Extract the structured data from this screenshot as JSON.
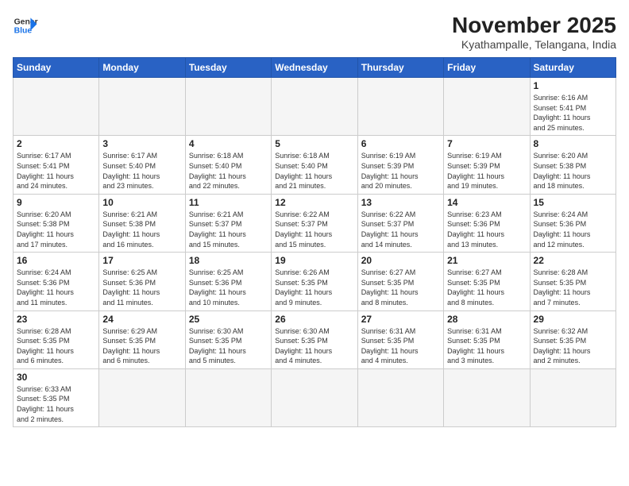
{
  "header": {
    "logo_line1": "General",
    "logo_line2": "Blue",
    "month_title": "November 2025",
    "subtitle": "Kyathampalle, Telangana, India"
  },
  "weekdays": [
    "Sunday",
    "Monday",
    "Tuesday",
    "Wednesday",
    "Thursday",
    "Friday",
    "Saturday"
  ],
  "weeks": [
    [
      {
        "day": "",
        "info": ""
      },
      {
        "day": "",
        "info": ""
      },
      {
        "day": "",
        "info": ""
      },
      {
        "day": "",
        "info": ""
      },
      {
        "day": "",
        "info": ""
      },
      {
        "day": "",
        "info": ""
      },
      {
        "day": "1",
        "info": "Sunrise: 6:16 AM\nSunset: 5:41 PM\nDaylight: 11 hours\nand 25 minutes."
      }
    ],
    [
      {
        "day": "2",
        "info": "Sunrise: 6:17 AM\nSunset: 5:41 PM\nDaylight: 11 hours\nand 24 minutes."
      },
      {
        "day": "3",
        "info": "Sunrise: 6:17 AM\nSunset: 5:40 PM\nDaylight: 11 hours\nand 23 minutes."
      },
      {
        "day": "4",
        "info": "Sunrise: 6:18 AM\nSunset: 5:40 PM\nDaylight: 11 hours\nand 22 minutes."
      },
      {
        "day": "5",
        "info": "Sunrise: 6:18 AM\nSunset: 5:40 PM\nDaylight: 11 hours\nand 21 minutes."
      },
      {
        "day": "6",
        "info": "Sunrise: 6:19 AM\nSunset: 5:39 PM\nDaylight: 11 hours\nand 20 minutes."
      },
      {
        "day": "7",
        "info": "Sunrise: 6:19 AM\nSunset: 5:39 PM\nDaylight: 11 hours\nand 19 minutes."
      },
      {
        "day": "8",
        "info": "Sunrise: 6:20 AM\nSunset: 5:38 PM\nDaylight: 11 hours\nand 18 minutes."
      }
    ],
    [
      {
        "day": "9",
        "info": "Sunrise: 6:20 AM\nSunset: 5:38 PM\nDaylight: 11 hours\nand 17 minutes."
      },
      {
        "day": "10",
        "info": "Sunrise: 6:21 AM\nSunset: 5:38 PM\nDaylight: 11 hours\nand 16 minutes."
      },
      {
        "day": "11",
        "info": "Sunrise: 6:21 AM\nSunset: 5:37 PM\nDaylight: 11 hours\nand 15 minutes."
      },
      {
        "day": "12",
        "info": "Sunrise: 6:22 AM\nSunset: 5:37 PM\nDaylight: 11 hours\nand 15 minutes."
      },
      {
        "day": "13",
        "info": "Sunrise: 6:22 AM\nSunset: 5:37 PM\nDaylight: 11 hours\nand 14 minutes."
      },
      {
        "day": "14",
        "info": "Sunrise: 6:23 AM\nSunset: 5:36 PM\nDaylight: 11 hours\nand 13 minutes."
      },
      {
        "day": "15",
        "info": "Sunrise: 6:24 AM\nSunset: 5:36 PM\nDaylight: 11 hours\nand 12 minutes."
      }
    ],
    [
      {
        "day": "16",
        "info": "Sunrise: 6:24 AM\nSunset: 5:36 PM\nDaylight: 11 hours\nand 11 minutes."
      },
      {
        "day": "17",
        "info": "Sunrise: 6:25 AM\nSunset: 5:36 PM\nDaylight: 11 hours\nand 11 minutes."
      },
      {
        "day": "18",
        "info": "Sunrise: 6:25 AM\nSunset: 5:36 PM\nDaylight: 11 hours\nand 10 minutes."
      },
      {
        "day": "19",
        "info": "Sunrise: 6:26 AM\nSunset: 5:35 PM\nDaylight: 11 hours\nand 9 minutes."
      },
      {
        "day": "20",
        "info": "Sunrise: 6:27 AM\nSunset: 5:35 PM\nDaylight: 11 hours\nand 8 minutes."
      },
      {
        "day": "21",
        "info": "Sunrise: 6:27 AM\nSunset: 5:35 PM\nDaylight: 11 hours\nand 8 minutes."
      },
      {
        "day": "22",
        "info": "Sunrise: 6:28 AM\nSunset: 5:35 PM\nDaylight: 11 hours\nand 7 minutes."
      }
    ],
    [
      {
        "day": "23",
        "info": "Sunrise: 6:28 AM\nSunset: 5:35 PM\nDaylight: 11 hours\nand 6 minutes."
      },
      {
        "day": "24",
        "info": "Sunrise: 6:29 AM\nSunset: 5:35 PM\nDaylight: 11 hours\nand 6 minutes."
      },
      {
        "day": "25",
        "info": "Sunrise: 6:30 AM\nSunset: 5:35 PM\nDaylight: 11 hours\nand 5 minutes."
      },
      {
        "day": "26",
        "info": "Sunrise: 6:30 AM\nSunset: 5:35 PM\nDaylight: 11 hours\nand 4 minutes."
      },
      {
        "day": "27",
        "info": "Sunrise: 6:31 AM\nSunset: 5:35 PM\nDaylight: 11 hours\nand 4 minutes."
      },
      {
        "day": "28",
        "info": "Sunrise: 6:31 AM\nSunset: 5:35 PM\nDaylight: 11 hours\nand 3 minutes."
      },
      {
        "day": "29",
        "info": "Sunrise: 6:32 AM\nSunset: 5:35 PM\nDaylight: 11 hours\nand 2 minutes."
      }
    ],
    [
      {
        "day": "30",
        "info": "Sunrise: 6:33 AM\nSunset: 5:35 PM\nDaylight: 11 hours\nand 2 minutes."
      },
      {
        "day": "",
        "info": ""
      },
      {
        "day": "",
        "info": ""
      },
      {
        "day": "",
        "info": ""
      },
      {
        "day": "",
        "info": ""
      },
      {
        "day": "",
        "info": ""
      },
      {
        "day": "",
        "info": ""
      }
    ]
  ]
}
